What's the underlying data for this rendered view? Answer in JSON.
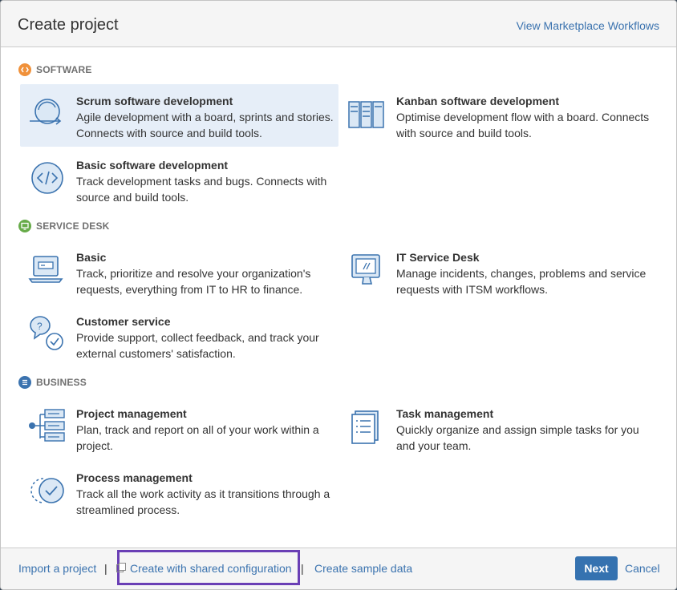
{
  "header": {
    "title": "Create project",
    "marketplace_link": "View Marketplace Workflows"
  },
  "sections": {
    "software": {
      "heading": "SOFTWARE",
      "icon": "code-icon",
      "color": "#f0913a",
      "items": [
        {
          "title": "Scrum software development",
          "desc": "Agile development with a board, sprints and stories. Connects with source and build tools.",
          "icon": "scrum-cycle-icon",
          "selected": true
        },
        {
          "title": "Kanban software development",
          "desc": "Optimise development flow with a board. Connects with source and build tools.",
          "icon": "kanban-board-icon"
        },
        {
          "title": "Basic software development",
          "desc": "Track development tasks and bugs. Connects with source and build tools.",
          "icon": "code-brackets-icon"
        }
      ]
    },
    "service_desk": {
      "heading": "SERVICE DESK",
      "icon": "monitor-icon",
      "color": "#67ab49",
      "items": [
        {
          "title": "Basic",
          "desc": "Track, prioritize and resolve your organization's requests, everything from IT to HR to finance.",
          "icon": "laptop-icon"
        },
        {
          "title": "IT Service Desk",
          "desc": "Manage incidents, changes, problems and service requests with ITSM workflows.",
          "icon": "desktop-monitor-icon"
        },
        {
          "title": "Customer service",
          "desc": "Provide support, collect feedback, and track your external customers' satisfaction.",
          "icon": "chat-question-icon"
        }
      ]
    },
    "business": {
      "heading": "BUSINESS",
      "icon": "list-icon",
      "color": "#3b73af",
      "items": [
        {
          "title": "Project management",
          "desc": "Plan, track and report on all of your work within a project.",
          "icon": "project-tree-icon"
        },
        {
          "title": "Task management",
          "desc": "Quickly organize and assign simple tasks for you and your team.",
          "icon": "task-list-icon"
        },
        {
          "title": "Process management",
          "desc": "Track all the work activity as it transitions through a streamlined process.",
          "icon": "process-check-icon"
        }
      ]
    }
  },
  "footer": {
    "import_link": "Import a project",
    "shared_config_link": "Create with shared configuration",
    "sample_data_link": "Create sample data",
    "separator": "|",
    "next_label": "Next",
    "cancel_label": "Cancel"
  },
  "colors": {
    "link": "#3b73af",
    "primary_button": "#3572b0",
    "selected_bg": "#e6eef8",
    "highlight": "#6a3fb5",
    "icon_stroke": "#3b73af"
  }
}
